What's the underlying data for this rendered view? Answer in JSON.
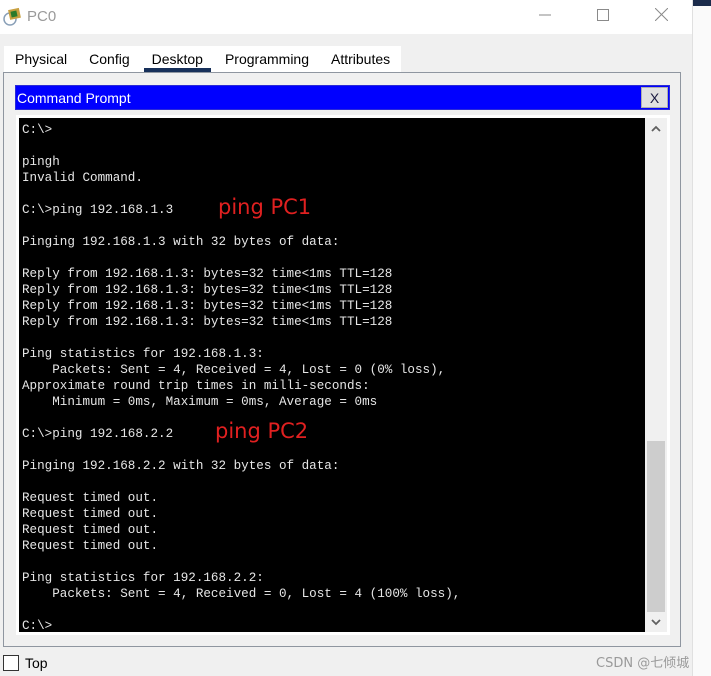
{
  "window": {
    "title": "PC0",
    "icon": "packet-tracer-pc-icon",
    "controls": {
      "minimize": "minimize-icon",
      "maximize": "maximize-icon",
      "close": "close-icon"
    }
  },
  "tabs": [
    {
      "label": "Physical",
      "active": false
    },
    {
      "label": "Config",
      "active": false
    },
    {
      "label": "Desktop",
      "active": true
    },
    {
      "label": "Programming",
      "active": false
    },
    {
      "label": "Attributes",
      "active": false
    }
  ],
  "command_prompt": {
    "title": "Command Prompt",
    "close_label": "X",
    "colors": {
      "titlebar": "#0000ff",
      "terminal_bg": "#000000",
      "terminal_fg": "#e6e6e6",
      "annotation": "#e02020"
    },
    "lines": [
      "C:\\>",
      "",
      "pingh",
      "Invalid Command.",
      "",
      "C:\\>ping 192.168.1.3",
      "",
      "Pinging 192.168.1.3 with 32 bytes of data:",
      "",
      "Reply from 192.168.1.3: bytes=32 time<1ms TTL=128",
      "Reply from 192.168.1.3: bytes=32 time<1ms TTL=128",
      "Reply from 192.168.1.3: bytes=32 time<1ms TTL=128",
      "Reply from 192.168.1.3: bytes=32 time<1ms TTL=128",
      "",
      "Ping statistics for 192.168.1.3:",
      "    Packets: Sent = 4, Received = 4, Lost = 0 (0% loss),",
      "Approximate round trip times in milli-seconds:",
      "    Minimum = 0ms, Maximum = 0ms, Average = 0ms",
      "",
      "C:\\>ping 192.168.2.2",
      "",
      "Pinging 192.168.2.2 with 32 bytes of data:",
      "",
      "Request timed out.",
      "Request timed out.",
      "Request timed out.",
      "Request timed out.",
      "",
      "Ping statistics for 192.168.2.2:",
      "    Packets: Sent = 4, Received = 0, Lost = 4 (100% loss),",
      "",
      "C:\\>"
    ],
    "annotations": [
      {
        "text": "ping PC1"
      },
      {
        "text": "ping PC2"
      }
    ],
    "scroll": {
      "position_fraction": 1.0
    }
  },
  "footer": {
    "top_checkbox_label": "Top",
    "top_checked": false,
    "watermark": "CSDN @七倾城"
  }
}
